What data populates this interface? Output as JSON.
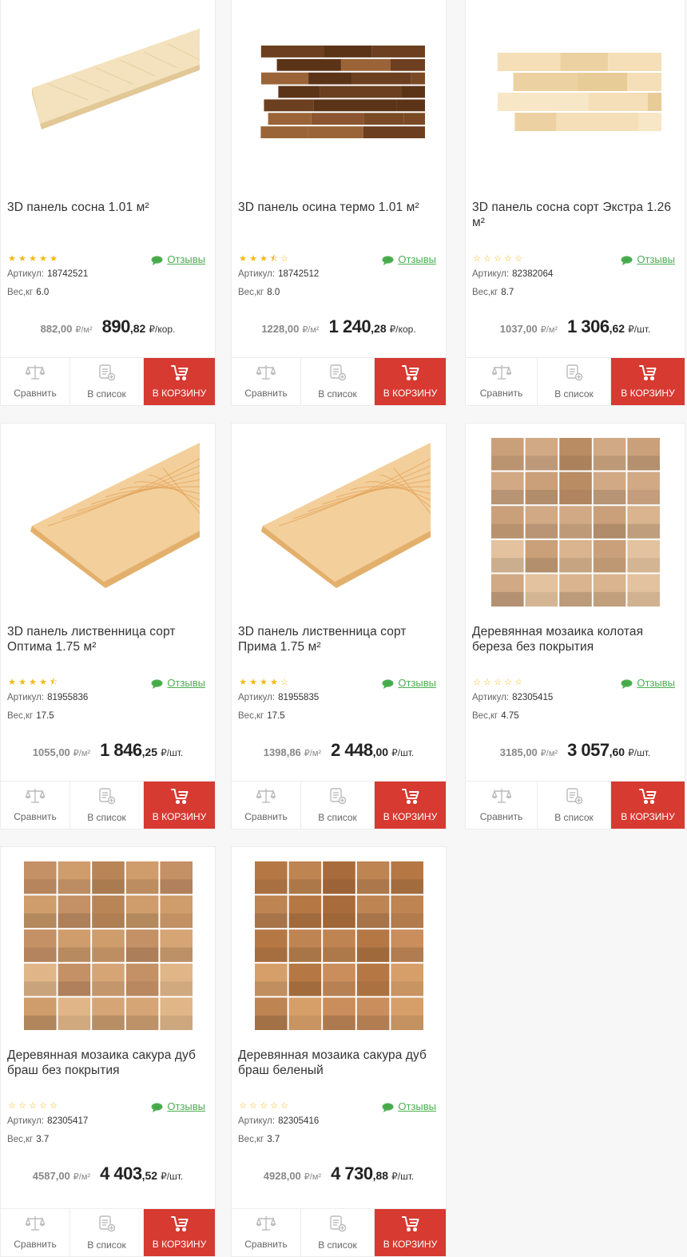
{
  "ui": {
    "reviews_label": "Отзывы",
    "article_label": "Артикул:",
    "weight_label": "Вес,кг",
    "compare_label": "Сравнить",
    "list_label": "В список",
    "cart_label": "В КОРЗИНУ",
    "unit_m2": "₽/м²",
    "accent_color": "#d63a31",
    "reviews_color": "#4caf50",
    "star_color": "#f5b914"
  },
  "products": [
    {
      "title": "3D панель сосна 1.01 м²",
      "rating": 5,
      "article": "18742521",
      "weight": "6.0",
      "price_old": "882,00",
      "price_main": "890",
      "price_cents": ",82",
      "price_unit": "₽/кор.",
      "image": "pine-board-icon"
    },
    {
      "title": "3D панель осина термо 1.01 м²",
      "rating": 3.5,
      "article": "18742512",
      "weight": "8.0",
      "price_old": "1228,00",
      "price_main": "1 240",
      "price_cents": ",28",
      "price_unit": "₽/кор.",
      "image": "dark-3d-panel-icon"
    },
    {
      "title": "3D панель сосна сорт Экстра 1.26 м²",
      "rating": 0,
      "article": "82382064",
      "weight": "8.7",
      "price_old": "1037,00",
      "price_main": "1 306",
      "price_cents": ",62",
      "price_unit": "₽/шт.",
      "image": "light-3d-panel-icon"
    },
    {
      "title": "3D панель лиственница сорт Оптима 1.75 м²",
      "rating": 4.5,
      "article": "81955836",
      "weight": "17.5",
      "price_old": "1055,00",
      "price_main": "1 846",
      "price_cents": ",25",
      "price_unit": "₽/шт.",
      "image": "larch-board-icon"
    },
    {
      "title": "3D панель лиственница сорт Прима 1.75 м²",
      "rating": 4,
      "article": "81955835",
      "weight": "17.5",
      "price_old": "1398,86",
      "price_main": "2 448",
      "price_cents": ",00",
      "price_unit": "₽/шт.",
      "image": "larch-board-icon"
    },
    {
      "title": "Деревянная мозаика колотая береза без покрытия",
      "rating": 0,
      "article": "82305415",
      "weight": "4.75",
      "price_old": "3185,00",
      "price_main": "3 057",
      "price_cents": ",60",
      "price_unit": "₽/шт.",
      "image": "birch-mosaic-icon"
    },
    {
      "title": "Деревянная мозаика сакура дуб браш без покрытия",
      "rating": 0,
      "article": "82305417",
      "weight": "3.7",
      "price_old": "4587,00",
      "price_main": "4 403",
      "price_cents": ",52",
      "price_unit": "₽/шт.",
      "image": "oak-mosaic-icon"
    },
    {
      "title": "Деревянная мозаика сакура дуб браш беленый",
      "rating": 0,
      "article": "82305416",
      "weight": "3.7",
      "price_old": "4928,00",
      "price_main": "4 730",
      "price_cents": ",88",
      "price_unit": "₽/шт.",
      "image": "oak-mosaic-dark-icon"
    }
  ]
}
